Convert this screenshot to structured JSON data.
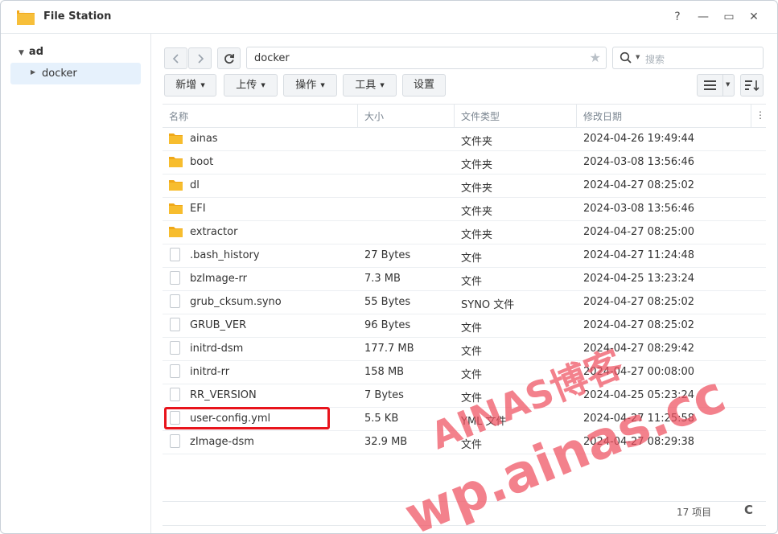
{
  "window": {
    "title": "File Station",
    "controls": [
      "?",
      "—",
      "▭",
      "✕"
    ]
  },
  "sidebar": {
    "root_label": "ad",
    "items": [
      {
        "label": "docker"
      }
    ]
  },
  "toolbar": {
    "path": "docker",
    "search_placeholder": "搜索",
    "buttons": {
      "create": "新增",
      "upload": "上传",
      "action": "操作",
      "tools": "工具",
      "settings": "设置"
    }
  },
  "columns": {
    "name": "名称",
    "size": "大小",
    "type": "文件类型",
    "modified": "修改日期"
  },
  "files": [
    {
      "name": "ainas",
      "size": "",
      "type": "文件夹",
      "modified": "2024-04-26 19:49:44",
      "kind": "folder"
    },
    {
      "name": "boot",
      "size": "",
      "type": "文件夹",
      "modified": "2024-03-08 13:56:46",
      "kind": "folder"
    },
    {
      "name": "dl",
      "size": "",
      "type": "文件夹",
      "modified": "2024-04-27 08:25:02",
      "kind": "folder"
    },
    {
      "name": "EFI",
      "size": "",
      "type": "文件夹",
      "modified": "2024-03-08 13:56:46",
      "kind": "folder"
    },
    {
      "name": "extractor",
      "size": "",
      "type": "文件夹",
      "modified": "2024-04-27 08:25:00",
      "kind": "folder"
    },
    {
      "name": ".bash_history",
      "size": "27 Bytes",
      "type": "文件",
      "modified": "2024-04-27 11:24:48",
      "kind": "file"
    },
    {
      "name": "bzImage-rr",
      "size": "7.3 MB",
      "type": "文件",
      "modified": "2024-04-25 13:23:24",
      "kind": "file"
    },
    {
      "name": "grub_cksum.syno",
      "size": "55 Bytes",
      "type": "SYNO 文件",
      "modified": "2024-04-27 08:25:02",
      "kind": "file"
    },
    {
      "name": "GRUB_VER",
      "size": "96 Bytes",
      "type": "文件",
      "modified": "2024-04-27 08:25:02",
      "kind": "file"
    },
    {
      "name": "initrd-dsm",
      "size": "177.7 MB",
      "type": "文件",
      "modified": "2024-04-27 08:29:42",
      "kind": "file"
    },
    {
      "name": "initrd-rr",
      "size": "158 MB",
      "type": "文件",
      "modified": "2024-04-27 00:08:00",
      "kind": "file"
    },
    {
      "name": "RR_VERSION",
      "size": "7 Bytes",
      "type": "文件",
      "modified": "2024-04-25 05:23:24",
      "kind": "file"
    },
    {
      "name": "user-config.yml",
      "size": "5.5 KB",
      "type": "YML 文件",
      "modified": "2024-04-27 11:25:58",
      "kind": "file"
    },
    {
      "name": "zImage-dsm",
      "size": "32.9 MB",
      "type": "文件",
      "modified": "2024-04-27 08:29:38",
      "kind": "file"
    }
  ],
  "footer": {
    "count": "17 项目",
    "refresh": "C"
  },
  "watermark": {
    "line1": "AINAS博客",
    "line2": "wp.ainas.cc"
  },
  "colors": {
    "accent": "#e6f1fc",
    "highlight": "#e8141c",
    "folder": "#f5b324",
    "watermark": "#ee5060"
  }
}
